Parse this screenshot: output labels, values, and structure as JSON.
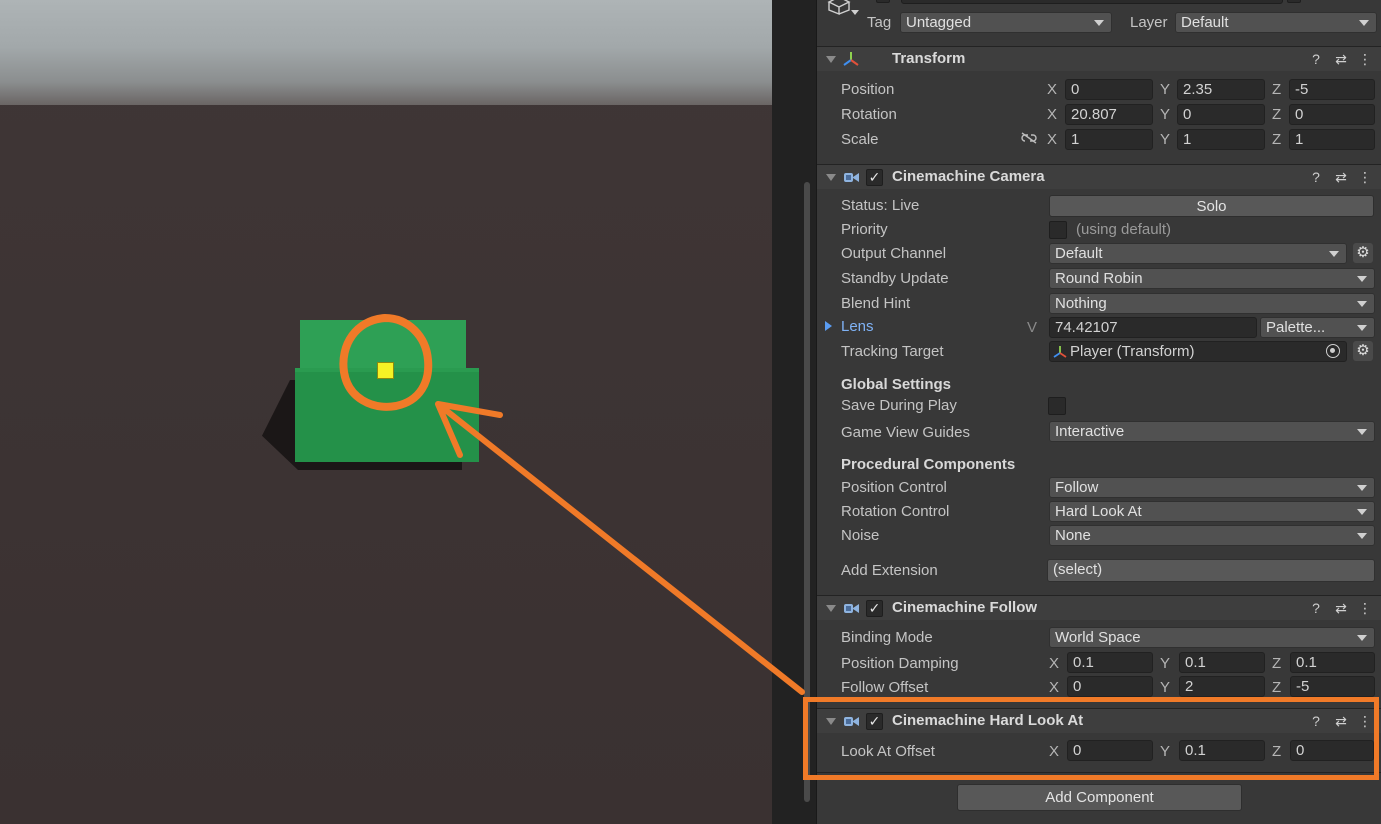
{
  "header": {
    "tag_label": "Tag",
    "tag_value": "Untagged",
    "layer_label": "Layer",
    "layer_value": "Default"
  },
  "transform": {
    "title": "Transform",
    "position_label": "Position",
    "rotation_label": "Rotation",
    "scale_label": "Scale",
    "position": {
      "x": "0",
      "y": "2.35",
      "z": "-5"
    },
    "rotation": {
      "x": "20.807",
      "y": "0",
      "z": "0"
    },
    "scale": {
      "x": "1",
      "y": "1",
      "z": "1"
    }
  },
  "axes": {
    "x": "X",
    "y": "Y",
    "z": "Z",
    "v": "V"
  },
  "cinemachine_camera": {
    "title": "Cinemachine Camera",
    "status_label": "Status: Live",
    "solo_button": "Solo",
    "priority_label": "Priority",
    "priority_hint": "(using default)",
    "output_channel_label": "Output Channel",
    "output_channel_value": "Default",
    "standby_update_label": "Standby Update",
    "standby_update_value": "Round Robin",
    "blend_hint_label": "Blend Hint",
    "blend_hint_value": "Nothing",
    "lens_label": "Lens",
    "lens_value": "74.42107",
    "lens_palette": "Palette...",
    "tracking_target_label": "Tracking Target",
    "tracking_target_value": "Player (Transform)",
    "global_settings_heading": "Global Settings",
    "save_during_play_label": "Save During Play",
    "game_view_guides_label": "Game View Guides",
    "game_view_guides_value": "Interactive",
    "procedural_heading": "Procedural Components",
    "position_control_label": "Position Control",
    "position_control_value": "Follow",
    "rotation_control_label": "Rotation Control",
    "rotation_control_value": "Hard Look At",
    "noise_label": "Noise",
    "noise_value": "None",
    "add_extension_label": "Add Extension",
    "add_extension_value": "(select)"
  },
  "cinemachine_follow": {
    "title": "Cinemachine Follow",
    "binding_mode_label": "Binding Mode",
    "binding_mode_value": "World Space",
    "position_damping_label": "Position Damping",
    "position_damping": {
      "x": "0.1",
      "y": "0.1",
      "z": "0.1"
    },
    "follow_offset_label": "Follow Offset",
    "follow_offset": {
      "x": "0",
      "y": "2",
      "z": "-5"
    }
  },
  "cinemachine_hard_look_at": {
    "title": "Cinemachine Hard Look At",
    "look_at_offset_label": "Look At Offset",
    "look_at_offset": {
      "x": "0",
      "y": "0.1",
      "z": "0"
    }
  },
  "add_component_button": "Add Component",
  "colors": {
    "annotation": "#f07a28",
    "player_cube": "#2ea055",
    "target_marker": "#f5f225",
    "inspector_bg": "#383838"
  }
}
